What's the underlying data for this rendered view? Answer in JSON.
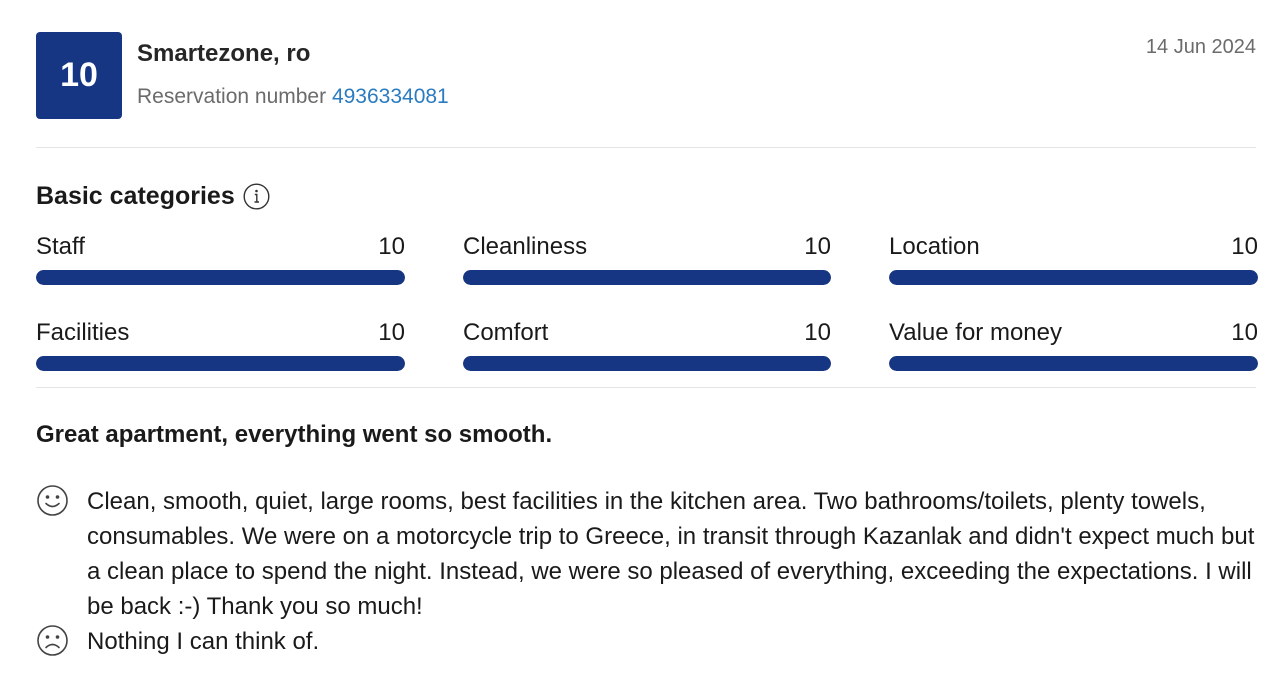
{
  "review": {
    "score": "10",
    "reviewer": "Smartezone, ro",
    "reservation_label": "Reservation number",
    "reservation_number": "4936334081",
    "date": "14 Jun 2024",
    "title": "Great apartment, everything went so smooth.",
    "positive": "Clean, smooth, quiet, large rooms, best facilities in the kitchen area. Two bathrooms/toilets, plenty towels, consumables. We were on a motorcycle trip to Greece, in transit through Kazanlak and didn't expect much but a clean place to spend the night. Instead, we were so pleased of everything, exceeding the expectations. I will be back :-) Thank you so much!",
    "negative": "Nothing I can think of."
  },
  "categories_section": {
    "title": "Basic categories",
    "info_icon": "info-icon",
    "items": [
      {
        "label": "Staff",
        "score": "10",
        "fraction": 1.0
      },
      {
        "label": "Cleanliness",
        "score": "10",
        "fraction": 1.0
      },
      {
        "label": "Location",
        "score": "10",
        "fraction": 1.0
      },
      {
        "label": "Facilities",
        "score": "10",
        "fraction": 1.0
      },
      {
        "label": "Comfort",
        "score": "10",
        "fraction": 1.0
      },
      {
        "label": "Value for money",
        "score": "10",
        "fraction": 1.0
      }
    ]
  },
  "icons": {
    "positive": "smiley-face-icon",
    "negative": "sad-face-icon"
  },
  "colors": {
    "brand": "#163582",
    "link": "#2a7bc0",
    "muted": "#6b6b6b"
  }
}
